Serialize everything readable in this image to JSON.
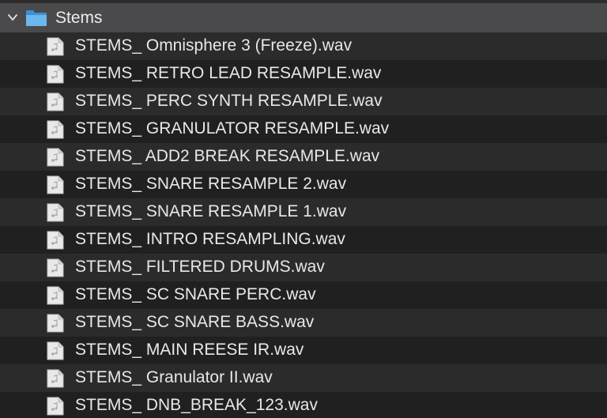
{
  "folder": {
    "name": "Stems",
    "expanded": true,
    "icon": "folder-icon",
    "accent_color": "#5aa9e6"
  },
  "files": [
    {
      "name": "STEMS_ Omnisphere 3 (Freeze).wav",
      "icon": "audio-file-icon"
    },
    {
      "name": "STEMS_ RETRO LEAD RESAMPLE.wav",
      "icon": "audio-file-icon"
    },
    {
      "name": "STEMS_ PERC SYNTH RESAMPLE.wav",
      "icon": "audio-file-icon"
    },
    {
      "name": "STEMS_ GRANULATOR RESAMPLE.wav",
      "icon": "audio-file-icon"
    },
    {
      "name": "STEMS_ ADD2 BREAK RESAMPLE.wav",
      "icon": "audio-file-icon"
    },
    {
      "name": "STEMS_ SNARE RESAMPLE 2.wav",
      "icon": "audio-file-icon"
    },
    {
      "name": "STEMS_ SNARE RESAMPLE 1.wav",
      "icon": "audio-file-icon"
    },
    {
      "name": "STEMS_ INTRO RESAMPLING.wav",
      "icon": "audio-file-icon"
    },
    {
      "name": "STEMS_ FILTERED DRUMS.wav",
      "icon": "audio-file-icon"
    },
    {
      "name": "STEMS_ SC SNARE PERC.wav",
      "icon": "audio-file-icon"
    },
    {
      "name": "STEMS_ SC SNARE BASS.wav",
      "icon": "audio-file-icon"
    },
    {
      "name": "STEMS_ MAIN REESE IR.wav",
      "icon": "audio-file-icon"
    },
    {
      "name": "STEMS_ Granulator II.wav",
      "icon": "audio-file-icon"
    },
    {
      "name": "STEMS_ DNB_BREAK_123.wav",
      "icon": "audio-file-icon"
    }
  ]
}
